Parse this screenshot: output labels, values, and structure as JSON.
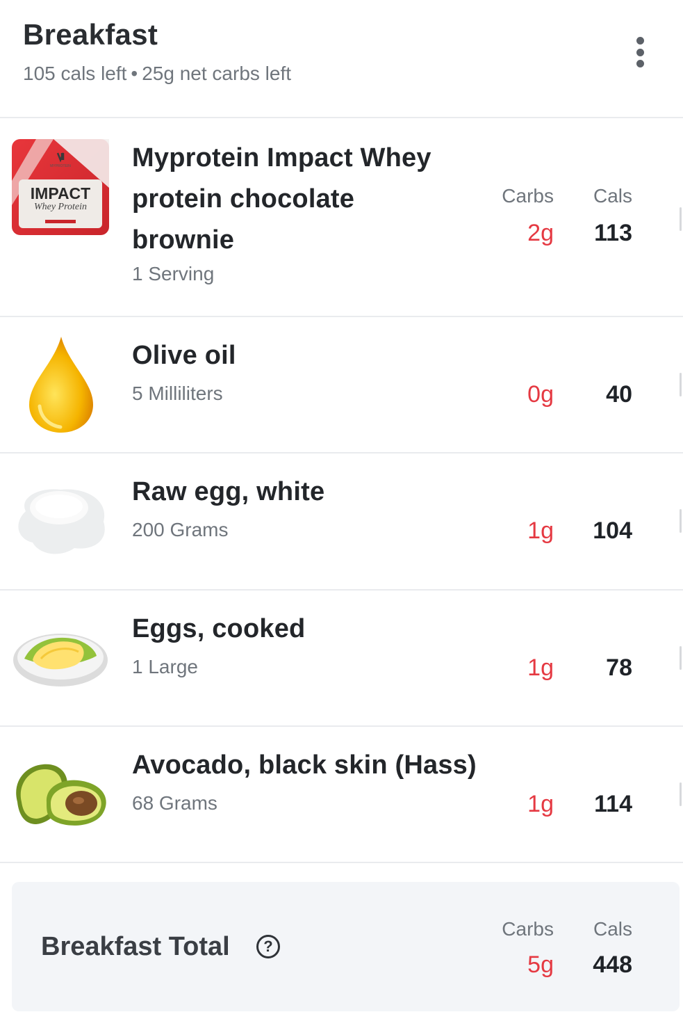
{
  "header": {
    "title": "Breakfast",
    "cals_left": "105 cals left",
    "separator": "•",
    "carbs_left": "25g net carbs left"
  },
  "columns": {
    "carbs": "Carbs",
    "cals": "Cals"
  },
  "items": [
    {
      "name_line1": "Myprotein Impact Whey",
      "name_line2": "protein chocolate",
      "name_line3": "brownie",
      "portion": "1 Serving",
      "carbs": "2g",
      "cals": "113",
      "image": "whey-protein-pack-icon",
      "pack_brand": "MYPROTEIN",
      "pack_title": "IMPACT",
      "pack_subtitle": "Whey Protein"
    },
    {
      "name": "Olive oil",
      "portion": "5 Milliliters",
      "carbs": "0g",
      "cals": "40",
      "image": "oil-drop-icon"
    },
    {
      "name": "Raw egg, white",
      "portion": "200 Grams",
      "carbs": "1g",
      "cals": "104",
      "image": "egg-white-icon"
    },
    {
      "name": "Eggs, cooked",
      "portion": "1 Large",
      "carbs": "1g",
      "cals": "78",
      "image": "omelette-icon"
    },
    {
      "name": "Avocado, black skin (Hass)",
      "portion": "68 Grams",
      "carbs": "1g",
      "cals": "114",
      "image": "avocado-icon"
    }
  ],
  "total": {
    "label": "Breakfast Total",
    "help_glyph": "?",
    "carbs_label": "Carbs",
    "cals_label": "Cals",
    "carbs": "5g",
    "cals": "448"
  },
  "colors": {
    "carbs": "#e53942",
    "divider": "#e9ebee",
    "total_bg": "#f3f5f8"
  }
}
